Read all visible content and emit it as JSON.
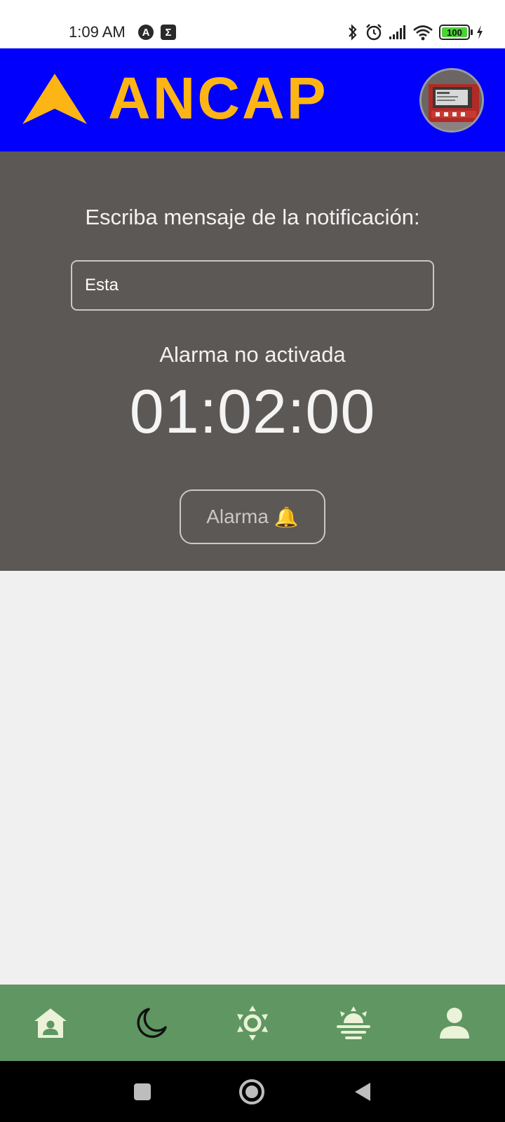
{
  "status_bar": {
    "time": "1:09 AM",
    "app_icons": [
      "A",
      "Σ"
    ],
    "battery": "100"
  },
  "header": {
    "logo_text": "ANCAP",
    "logo_color": "#fdb515",
    "background": "#0000fc"
  },
  "alarm": {
    "prompt": "Escriba mensaje de la notificación:",
    "message_value": "Esta",
    "status": "Alarma no activada",
    "time": "01:02:00",
    "button_label": "Alarma",
    "button_emoji": "🔔"
  },
  "bottom_nav": {
    "background": "#5f9662",
    "items": [
      {
        "icon": "home-user-icon"
      },
      {
        "icon": "moon-icon",
        "active": true
      },
      {
        "icon": "sun-icon"
      },
      {
        "icon": "sunrise-icon"
      },
      {
        "icon": "person-icon"
      }
    ]
  },
  "system_nav": {
    "items": [
      "recents-icon",
      "home-icon",
      "back-icon"
    ]
  }
}
